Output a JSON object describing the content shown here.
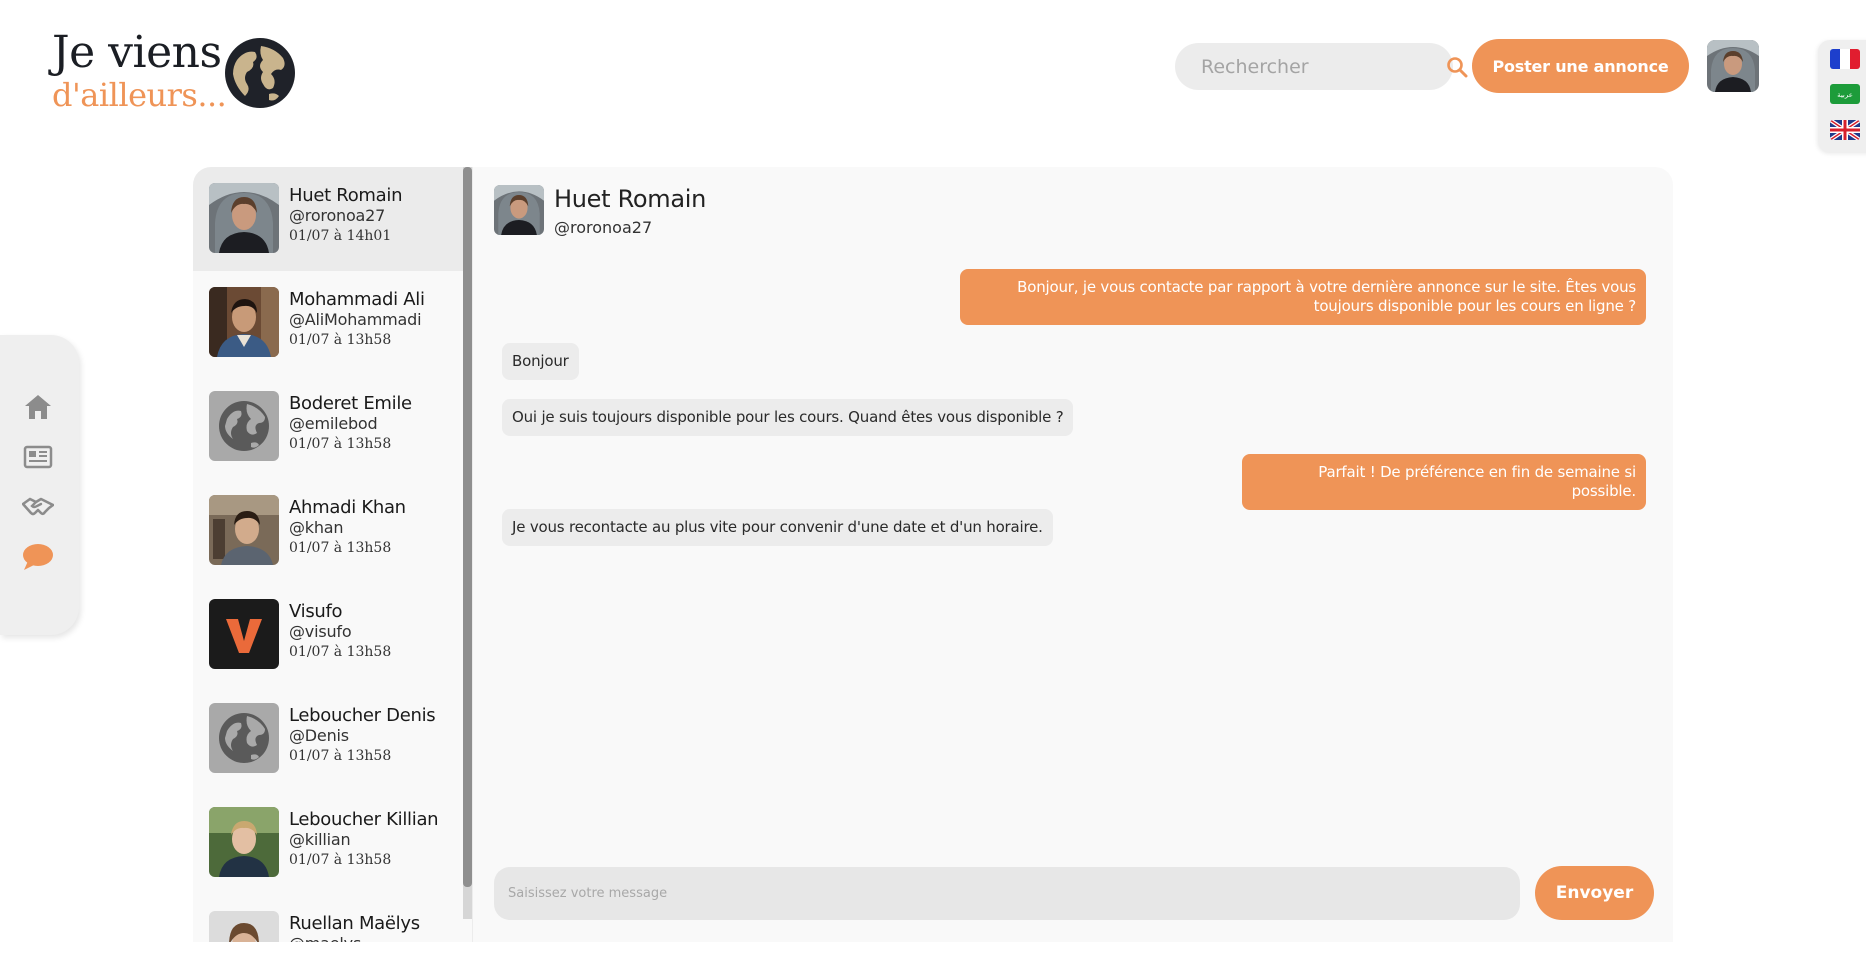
{
  "logo": {
    "line1": "Je viens",
    "line2": "d'ailleurs..."
  },
  "header": {
    "search_placeholder": "Rechercher",
    "post_button": "Poster une annonce"
  },
  "languages": [
    "fr",
    "ar",
    "en"
  ],
  "nav": [
    "home-icon",
    "news-icon",
    "handshake-icon",
    "chat-icon"
  ],
  "colors": {
    "accent": "#ef9457",
    "dark": "#1b1e24",
    "bubble_them": "#ececec"
  },
  "contacts": [
    {
      "name": "Huet Romain",
      "handle": "@roronoa27",
      "time": "01/07 à 14h01",
      "active": true,
      "avatar": "photo-man-hoodie"
    },
    {
      "name": "Mohammadi Ali",
      "handle": "@AliMohammadi",
      "time": "01/07 à 13h58",
      "avatar": "photo-young-man"
    },
    {
      "name": "Boderet Emile",
      "handle": "@emilebod",
      "time": "01/07 à 13h58",
      "avatar": "default-globe"
    },
    {
      "name": "Ahmadi Khan",
      "handle": "@khan",
      "time": "01/07 à 13h58",
      "avatar": "photo-man-glasses"
    },
    {
      "name": "Visufo",
      "handle": "@visufo",
      "time": "01/07 à 13h58",
      "avatar": "logo-v"
    },
    {
      "name": "Leboucher Denis",
      "handle": "@Denis",
      "time": "01/07 à 13h58",
      "avatar": "default-globe"
    },
    {
      "name": "Leboucher Killian",
      "handle": "@killian",
      "time": "01/07 à 13h58",
      "avatar": "photo-blond-man"
    },
    {
      "name": "Ruellan Maëlys",
      "handle": "@maelys",
      "time": "",
      "avatar": "photo-woman"
    }
  ],
  "conversation": {
    "name": "Huet Romain",
    "handle": "@roronoa27",
    "messages": [
      {
        "from": "me",
        "text": "Bonjour, je vous contacte par rapport à votre dernière annonce sur le site. Êtes vous toujours disponible pour les cours en ligne ?"
      },
      {
        "from": "them",
        "text": "Bonjour"
      },
      {
        "from": "them",
        "text": "Oui je suis toujours disponible pour les cours. Quand êtes vous disponible ?"
      },
      {
        "from": "me",
        "text": "Parfait ! De préférence en fin de semaine si possible."
      },
      {
        "from": "them",
        "text": "Je vous recontacte au plus vite pour convenir d'une date et d'un horaire."
      }
    ],
    "input_placeholder": "Saisissez votre message",
    "send_button": "Envoyer"
  }
}
